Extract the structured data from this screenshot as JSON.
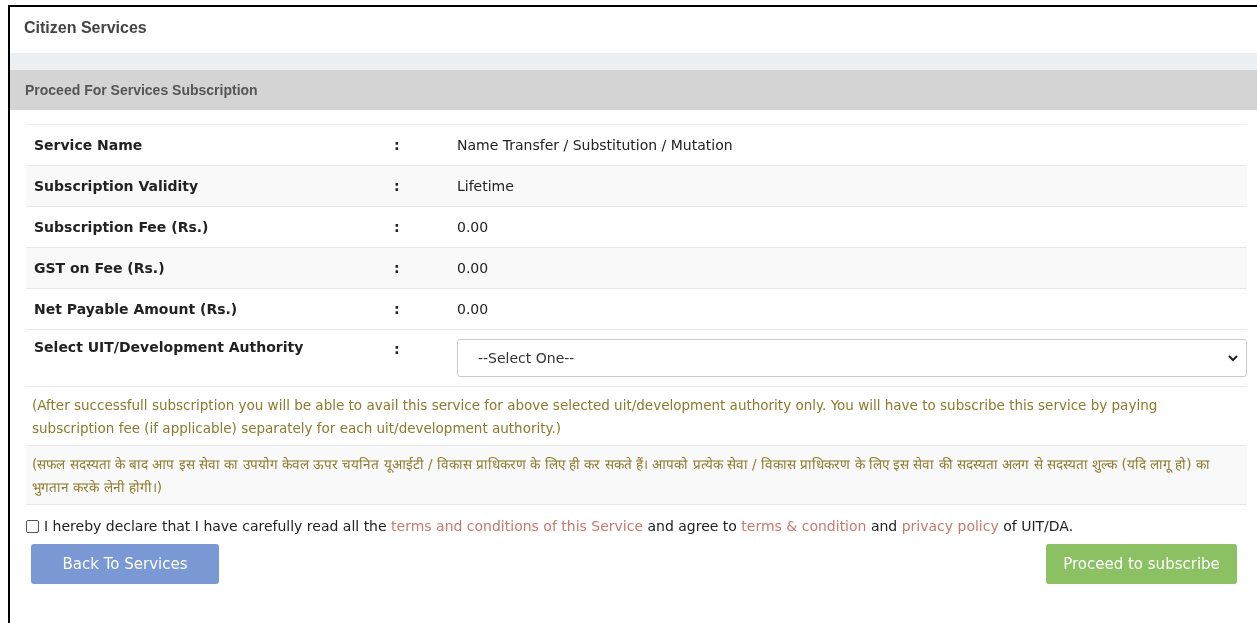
{
  "page_title": "Citizen Services",
  "section_title": "Proceed For Services Subscription",
  "rows": [
    {
      "label": "Service Name",
      "separator": ":",
      "value": "Name Transfer / Substitution / Mutation"
    },
    {
      "label": "Subscription Validity",
      "separator": ":",
      "value": "Lifetime"
    },
    {
      "label": "Subscription Fee (Rs.)",
      "separator": ":",
      "value": "0.00"
    },
    {
      "label": "GST on Fee (Rs.)",
      "separator": ":",
      "value": "0.00"
    },
    {
      "label": "Net Payable Amount (Rs.)",
      "separator": ":",
      "value": "0.00"
    }
  ],
  "authority": {
    "label": "Select UIT/Development Authority",
    "separator": ":",
    "value": "--Select One--"
  },
  "notes": [
    "(After successfull subscription you will be able to avail this service for above selected uit/development authority only. You will have to subscribe this service by paying subscription fee (if applicable) separately for each uit/development authority.)",
    "(सफल सदस्यता के बाद आप इस सेवा का उपयोग केवल ऊपर चयनित यूआईटी / विकास प्राधिकरण के लिए ही कर सकते हैं। आपको प्रत्येक सेवा / विकास प्राधिकरण के लिए इस सेवा की सदस्यता अलग से सदस्यता शुल्क (यदि लागू हो) का भुगतान करके लेनी होगी।)"
  ],
  "declaration": {
    "checked": false,
    "parts": [
      {
        "kind": "text",
        "text": "I hereby declare that I have carefully read all the "
      },
      {
        "kind": "link",
        "text": "terms and conditions of this Service"
      },
      {
        "kind": "text",
        "text": " and agree to "
      },
      {
        "kind": "link",
        "text": "terms & condition"
      },
      {
        "kind": "text",
        "text": " and "
      },
      {
        "kind": "link",
        "text": "privacy policy"
      },
      {
        "kind": "text",
        "text": " of UIT/DA."
      }
    ]
  },
  "buttons": {
    "back": "Back To Services",
    "proceed": "Proceed to subscribe"
  }
}
